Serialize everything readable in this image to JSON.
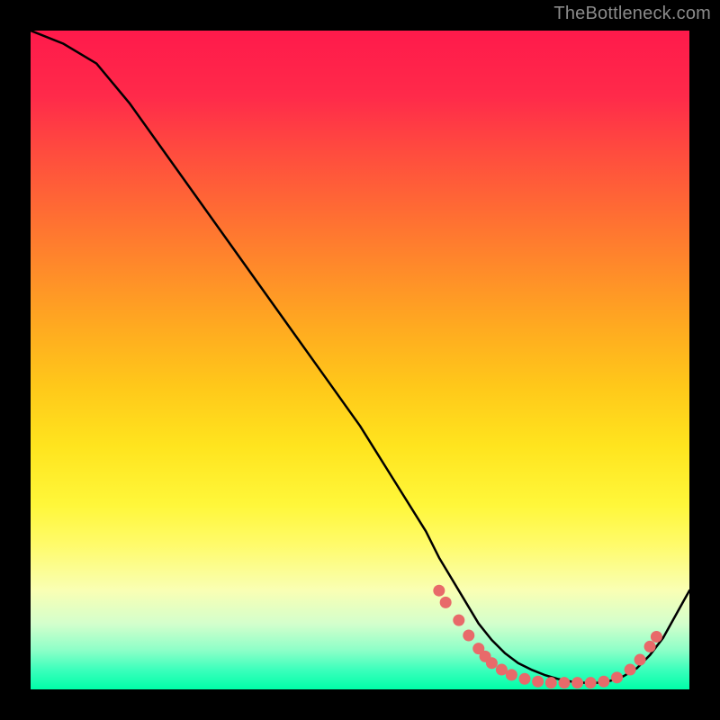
{
  "attribution": "TheBottleneck.com",
  "colors": {
    "background": "#000000",
    "gradient_top": "#ff1a4b",
    "gradient_bottom": "#00ffa8",
    "curve": "#000000",
    "marker": "#e86a6a"
  },
  "chart_data": {
    "type": "line",
    "title": "",
    "xlabel": "",
    "ylabel": "",
    "xlim": [
      0,
      100
    ],
    "ylim": [
      0,
      100
    ],
    "series": [
      {
        "name": "curve",
        "x": [
          0,
          5,
          10,
          15,
          20,
          25,
          30,
          35,
          40,
          45,
          50,
          55,
          60,
          62,
          65,
          68,
          70,
          72,
          74,
          76,
          78,
          80,
          82,
          84,
          86,
          88,
          90,
          92,
          94,
          96,
          100
        ],
        "y": [
          100,
          98,
          95,
          89,
          82,
          75,
          68,
          61,
          54,
          47,
          40,
          32,
          24,
          20,
          15,
          10,
          7.5,
          5.5,
          4,
          3,
          2.2,
          1.6,
          1.2,
          1,
          1,
          1.3,
          2,
          3.2,
          5.2,
          7.8,
          15
        ]
      }
    ],
    "markers": [
      {
        "x": 62.0,
        "y": 15.0
      },
      {
        "x": 63.0,
        "y": 13.2
      },
      {
        "x": 65.0,
        "y": 10.5
      },
      {
        "x": 66.5,
        "y": 8.2
      },
      {
        "x": 68.0,
        "y": 6.2
      },
      {
        "x": 69.0,
        "y": 5.0
      },
      {
        "x": 70.0,
        "y": 4.0
      },
      {
        "x": 71.5,
        "y": 3.0
      },
      {
        "x": 73.0,
        "y": 2.2
      },
      {
        "x": 75.0,
        "y": 1.6
      },
      {
        "x": 77.0,
        "y": 1.2
      },
      {
        "x": 79.0,
        "y": 1.0
      },
      {
        "x": 81.0,
        "y": 1.0
      },
      {
        "x": 83.0,
        "y": 1.0
      },
      {
        "x": 85.0,
        "y": 1.0
      },
      {
        "x": 87.0,
        "y": 1.2
      },
      {
        "x": 89.0,
        "y": 1.8
      },
      {
        "x": 91.0,
        "y": 3.0
      },
      {
        "x": 92.5,
        "y": 4.5
      },
      {
        "x": 94.0,
        "y": 6.5
      },
      {
        "x": 95.0,
        "y": 8.0
      }
    ]
  }
}
